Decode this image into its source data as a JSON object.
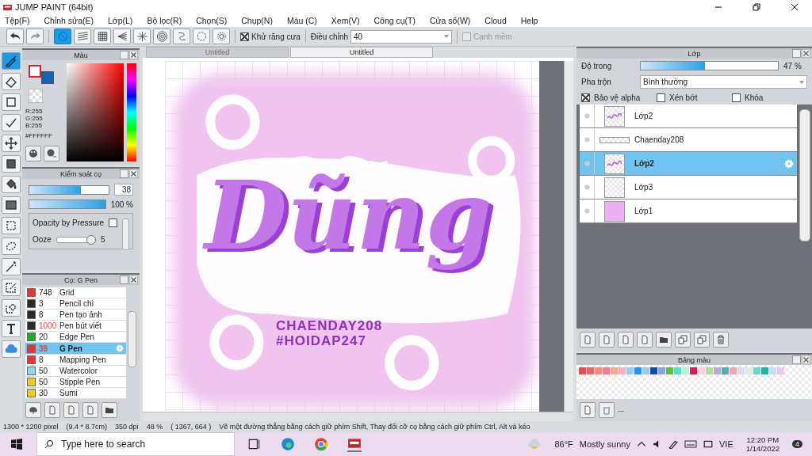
{
  "window": {
    "title": "JUMP PAINT (64bit)"
  },
  "menu": [
    "Tệp(F)",
    "Chỉnh sửa(E)",
    "Lớp(L)",
    "Bộ lọc(R)",
    "Chọn(S)",
    "Chụp(N)",
    "Màu (C)",
    "Xem(V)",
    "Công cụ(T)",
    "Cửa sổ(W)",
    "Cloud",
    "Help"
  ],
  "toolbar": {
    "history": [
      {
        "kind": "undo"
      },
      {
        "kind": "redo"
      }
    ],
    "rulers": [
      {
        "kind": "none",
        "selected": true
      },
      {
        "kind": "parallel",
        "selected": false
      },
      {
        "kind": "grid",
        "selected": false
      },
      {
        "kind": "perspective",
        "selected": false
      },
      {
        "kind": "radial",
        "selected": false
      },
      {
        "kind": "concentric",
        "selected": false
      },
      {
        "kind": "curve",
        "selected": false
      },
      {
        "kind": "ellipse",
        "selected": false
      },
      {
        "kind": "gear",
        "selected": false
      }
    ],
    "antialias": {
      "label": "Khử răng cưa",
      "checked": true
    },
    "adjust": {
      "label": "Điều chỉnh",
      "value": "40"
    },
    "soft_edge": {
      "label": "Cạnh mềm",
      "checked": false,
      "disabled": true
    }
  },
  "tools": [
    {
      "kind": "brush",
      "selected": true
    },
    {
      "kind": "eraser",
      "selected": false
    },
    {
      "kind": "rect",
      "selected": false
    },
    {
      "kind": "polyline",
      "selected": false
    },
    {
      "kind": "move",
      "selected": false
    },
    {
      "kind": "fill",
      "selected": false
    },
    {
      "kind": "bucket",
      "selected": false
    },
    {
      "kind": "gradient",
      "selected": false
    },
    {
      "kind": "select",
      "selected": false
    },
    {
      "kind": "lasso",
      "selected": false
    },
    {
      "kind": "wand",
      "selected": false
    },
    {
      "kind": "selpen",
      "selected": false
    },
    {
      "kind": "selerase",
      "selected": false
    },
    {
      "kind": "text",
      "selected": false
    },
    {
      "kind": "cloud",
      "selected": false
    }
  ],
  "color_panel": {
    "title": "Màu",
    "rgb": [
      "R:255",
      "G:255",
      "B:255"
    ],
    "hex": "#FFFFFF"
  },
  "brush_control": {
    "title": "Kiểm soát cọ",
    "size": {
      "level": 0.65,
      "value": "38"
    },
    "opacity": {
      "level": 1,
      "reading": "100 %"
    },
    "pressure": {
      "label": "Opacity by Pressure",
      "checked": false
    },
    "ooze": {
      "label": "Ooze",
      "level": 0.9,
      "reading": "5"
    }
  },
  "brushes": {
    "title": "Cọ: G Pen",
    "items": [
      {
        "size": "748",
        "name": "Grid",
        "color": "#ee3333",
        "selected": false,
        "warning": false
      },
      {
        "size": "3",
        "name": "Pencil chì",
        "color": "#2a2a2a",
        "selected": false,
        "warning": false
      },
      {
        "size": "8",
        "name": "Pen tạo ảnh",
        "color": "#2a2a2a",
        "selected": false,
        "warning": false
      },
      {
        "size": "1000",
        "name": "Pen bút viết",
        "color": "#2a2a2a",
        "selected": false,
        "warning": true
      },
      {
        "size": "20",
        "name": "Edge Pen",
        "color": "#22aa22",
        "selected": false,
        "warning": false
      },
      {
        "size": "38",
        "name": "G Pen",
        "color": "#ee3333",
        "selected": true,
        "warning": true
      },
      {
        "size": "8",
        "name": "Mapping Pen",
        "color": "#ee3333",
        "selected": false,
        "warning": false
      },
      {
        "size": "50",
        "name": "Watercolor",
        "color": "#88d8f0",
        "selected": false,
        "warning": false
      },
      {
        "size": "50",
        "name": "Stipple Pen",
        "color": "#e8d020",
        "selected": false,
        "warning": false
      },
      {
        "size": "30",
        "name": "Sumi",
        "color": "#e8d020",
        "selected": false,
        "warning": false
      }
    ]
  },
  "tabs": [
    {
      "label": "Untitled",
      "selected": false
    },
    {
      "label": "Untitled",
      "selected": true
    }
  ],
  "canvas": {
    "lettering": "Dũng",
    "captions": [
      "CHAENDAY208",
      "#HOIDAP247"
    ]
  },
  "layers": {
    "title": "Lớp",
    "opacity": {
      "label": "Độ trong",
      "level": 0.47,
      "reading": "47 %"
    },
    "blend": {
      "label": "Pha trộn",
      "value": "Bình thường"
    },
    "options": [
      {
        "label": "Bảo vệ alpha",
        "checked": true
      },
      {
        "label": "Xén bớt",
        "checked": false
      },
      {
        "label": "Khóa",
        "checked": false
      }
    ],
    "items": [
      {
        "name": "Lớp2",
        "kind": "lettering",
        "selected": false
      },
      {
        "name": "Chaenday208",
        "kind": "strip",
        "selected": false
      },
      {
        "name": "Lớp2",
        "kind": "lettering",
        "selected": true
      },
      {
        "name": "Lớp3",
        "kind": "empty",
        "selected": false
      },
      {
        "name": "Lớp1",
        "kind": "pink",
        "selected": false
      }
    ]
  },
  "swatches": {
    "title": "Bảng màu",
    "footer": "---",
    "colors": [
      {
        "color": "#f24b4b"
      },
      {
        "color": "#e56a6a"
      },
      {
        "color": "#f78a7e"
      },
      {
        "color": "#f27b95"
      },
      {
        "color": "#f7a68c"
      },
      {
        "color": "#f5aec4"
      },
      {
        "color": "#92cdf5"
      },
      {
        "color": "#2d8ff0"
      },
      {
        "color": "#9ccbe0"
      },
      {
        "color": "#0c4ea3"
      },
      {
        "color": "#8ea3d6"
      },
      {
        "color": "#5cbd44"
      },
      {
        "color": "#52e0c8"
      },
      {
        "color": "#b5f0dc"
      },
      {
        "color": "#d81b5e"
      },
      {
        "color": "#f9d4dc"
      },
      {
        "color": "#b3dc9c"
      },
      {
        "color": "#bca8cc"
      },
      {
        "color": "#5aaab4"
      },
      {
        "color": "#f4a4ac"
      },
      {
        "color": "#dcdcec"
      },
      {
        "color": "#e4e8e4"
      },
      {
        "color": "#6cd4c0"
      },
      {
        "color": "#1fb4a0"
      },
      {
        "color": "#c8dcf4"
      },
      {
        "color": "#ecc8ec"
      }
    ]
  },
  "status_bar": {
    "size": "1300 * 1200 pixel",
    "physical": "(9.4 * 8.7cm)",
    "dpi": "350 dpi",
    "zoom": "48 %",
    "position": "( 1367, 664 )",
    "hint": "Vẽ một đường thẳng bằng cách giữ phím Shift, Thay đổi cỡ cọ bằng cách giữ phím Ctrl, Alt và kéo"
  },
  "taskbar": {
    "search_placeholder": "Type here to search",
    "temperature": "86°F",
    "weather": "Mostly sunny",
    "language": "VIE",
    "time": "12:20 PM",
    "date": "1/14/2022",
    "notifications": "4"
  }
}
